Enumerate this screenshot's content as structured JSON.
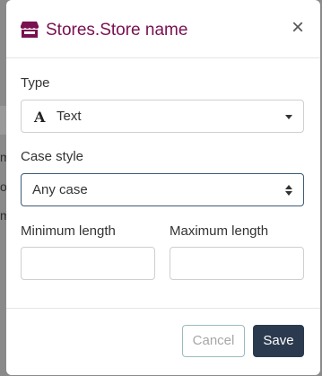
{
  "modal": {
    "title": "Stores.Store name",
    "close_glyph": "×",
    "title_icon": "store-icon"
  },
  "form": {
    "type": {
      "label": "Type",
      "value": "Text",
      "icon": "text-type-icon",
      "icon_glyph": "A"
    },
    "case_style": {
      "label": "Case style",
      "value": "Any case"
    },
    "min_length": {
      "label": "Minimum length",
      "value": ""
    },
    "max_length": {
      "label": "Maximum length",
      "value": ""
    }
  },
  "footer": {
    "cancel_label": "Cancel",
    "save_label": "Save"
  },
  "background": {
    "fragments": [
      "m",
      "o",
      "m"
    ]
  },
  "colors": {
    "title": "#7a1150",
    "save_bg": "#2b3a4e",
    "focus_border": "#3d5a7a",
    "overlay": "#8a8a8a"
  }
}
